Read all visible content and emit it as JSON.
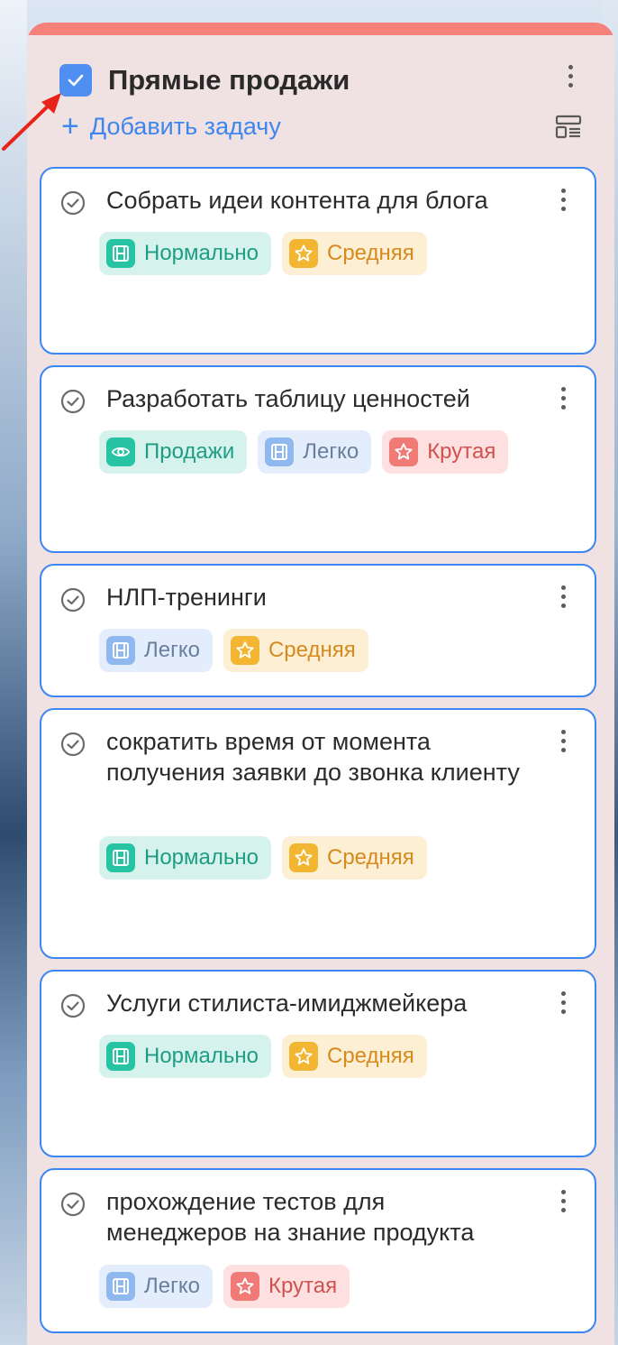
{
  "column": {
    "title": "Прямые продажи",
    "add_task_label": "Добавить задачу"
  },
  "colors": {
    "accent": "#3b86f2",
    "column_top_bar": "#f4827a",
    "column_bg": "#f0e2e3"
  },
  "cards": [
    {
      "title": "Собрать идеи контента для блога",
      "tags": [
        {
          "label": "Нормально",
          "style": "teal",
          "icon": "film-icon"
        },
        {
          "label": "Средняя",
          "style": "yellow",
          "icon": "star-icon"
        }
      ]
    },
    {
      "title": "Разработать таблицу ценностей",
      "tags": [
        {
          "label": "Продажи",
          "style": "teal",
          "icon": "eye-icon"
        },
        {
          "label": "Легко",
          "style": "blue",
          "icon": "film-icon"
        },
        {
          "label": "Крутая",
          "style": "red",
          "icon": "star-icon"
        }
      ]
    },
    {
      "title": "НЛП-тренинги",
      "tags": [
        {
          "label": "Легко",
          "style": "blue",
          "icon": "film-icon"
        },
        {
          "label": "Средняя",
          "style": "yellow",
          "icon": "star-icon"
        }
      ]
    },
    {
      "title": "сократить время от момента получения заявки до звонка клиенту",
      "tags": [
        {
          "label": "Нормально",
          "style": "teal",
          "icon": "film-icon"
        },
        {
          "label": "Средняя",
          "style": "yellow",
          "icon": "star-icon"
        }
      ]
    },
    {
      "title": "Услуги стилиста-имиджмейкера",
      "tags": [
        {
          "label": "Нормально",
          "style": "teal",
          "icon": "film-icon"
        },
        {
          "label": "Средняя",
          "style": "yellow",
          "icon": "star-icon"
        }
      ]
    },
    {
      "title": "прохождение тестов для менеджеров на знание продукта",
      "tags": [
        {
          "label": "Легко",
          "style": "blue",
          "icon": "film-icon"
        },
        {
          "label": "Крутая",
          "style": "red",
          "icon": "star-icon"
        }
      ]
    }
  ]
}
